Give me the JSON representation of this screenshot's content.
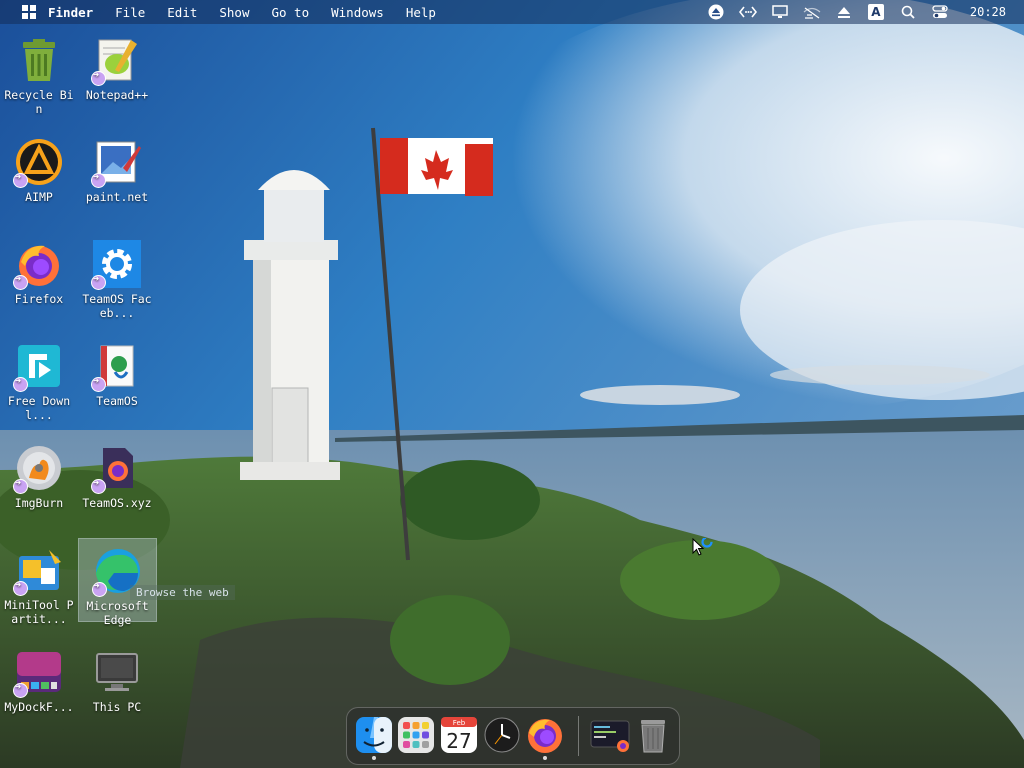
{
  "menubar": {
    "items": [
      {
        "label": "Finder"
      },
      {
        "label": "File"
      },
      {
        "label": "Edit"
      },
      {
        "label": "Show"
      },
      {
        "label": "Go to"
      },
      {
        "label": "Windows"
      },
      {
        "label": "Help"
      }
    ],
    "tray": {
      "icons": [
        "eject-icon",
        "code-icon",
        "display-icon",
        "network-off-icon",
        "upload-icon",
        "keyboard-layout-icon",
        "search-icon",
        "control-center-icon"
      ],
      "keyboard_layout": "A",
      "clock": "20:28"
    }
  },
  "desktop": {
    "icons": [
      {
        "label": "Recycle Bin",
        "icon": "recycle-bin-icon"
      },
      {
        "label": "Notepad++",
        "icon": "notepad-plus-plus-icon"
      },
      {
        "label": "AIMP",
        "icon": "aimp-icon"
      },
      {
        "label": "paint.net",
        "icon": "paint-net-icon"
      },
      {
        "label": "Firefox",
        "icon": "firefox-icon"
      },
      {
        "label": "TeamOS Faceb...",
        "icon": "gear-icon"
      },
      {
        "label": "Free Downl...",
        "icon": "free-download-manager-icon"
      },
      {
        "label": "TeamOS",
        "icon": "teamos-icon"
      },
      {
        "label": "ImgBurn",
        "icon": "imgburn-icon"
      },
      {
        "label": "TeamOS.xyz",
        "icon": "teamos-xyz-icon"
      },
      {
        "label": "MiniTool Partit...",
        "icon": "minitool-partition-icon"
      },
      {
        "label": "Microsoft Edge",
        "icon": "edge-icon"
      },
      {
        "label": "MyDockF...",
        "icon": "mydockfinder-icon"
      },
      {
        "label": "This PC",
        "icon": "computer-icon"
      }
    ],
    "tooltip": "Browse the web"
  },
  "dock": {
    "items": [
      {
        "name": "finder",
        "icon": "finder-icon",
        "running": true
      },
      {
        "name": "launchpad",
        "icon": "launchpad-icon",
        "running": false
      },
      {
        "name": "calendar",
        "icon": "calendar-icon",
        "running": false,
        "month": "Feb",
        "day": "27"
      },
      {
        "name": "clock",
        "icon": "clock-icon",
        "running": false
      },
      {
        "name": "firefox",
        "icon": "firefox-icon",
        "running": true
      },
      {
        "name": "terminal",
        "icon": "terminal-icon",
        "running": false
      },
      {
        "name": "trash",
        "icon": "trash-icon",
        "running": false
      }
    ]
  },
  "colors": {
    "menubar_bg": "#1f3a6a",
    "flag_red": "#d52b1e",
    "sky": "#2a6fb6",
    "sea": "#5f8bb0"
  }
}
